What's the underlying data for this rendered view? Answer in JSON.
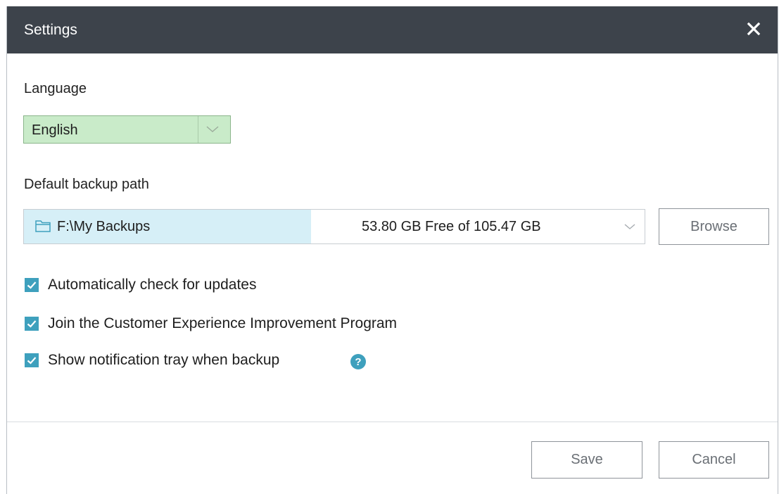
{
  "dialog": {
    "title": "Settings",
    "close_icon": "close-icon"
  },
  "language": {
    "label": "Language",
    "selected": "English",
    "accent": "#c9ebc9"
  },
  "backup": {
    "label": "Default backup path",
    "path": "F:\\My Backups",
    "free_space": "53.80 GB Free of 105.47 GB",
    "browse_label": "Browse",
    "folder_icon": "folder-icon"
  },
  "options": [
    {
      "label": "Automatically check for updates",
      "checked": true
    },
    {
      "label": "Join the Customer Experience Improvement Program",
      "checked": true
    },
    {
      "label": "Show notification tray when backup",
      "checked": true
    }
  ],
  "footer": {
    "save_label": "Save",
    "cancel_label": "Cancel"
  },
  "colors": {
    "titlebar": "#3d434b",
    "checkbox": "#3ea0bd",
    "path_highlight": "#d6eff7"
  }
}
